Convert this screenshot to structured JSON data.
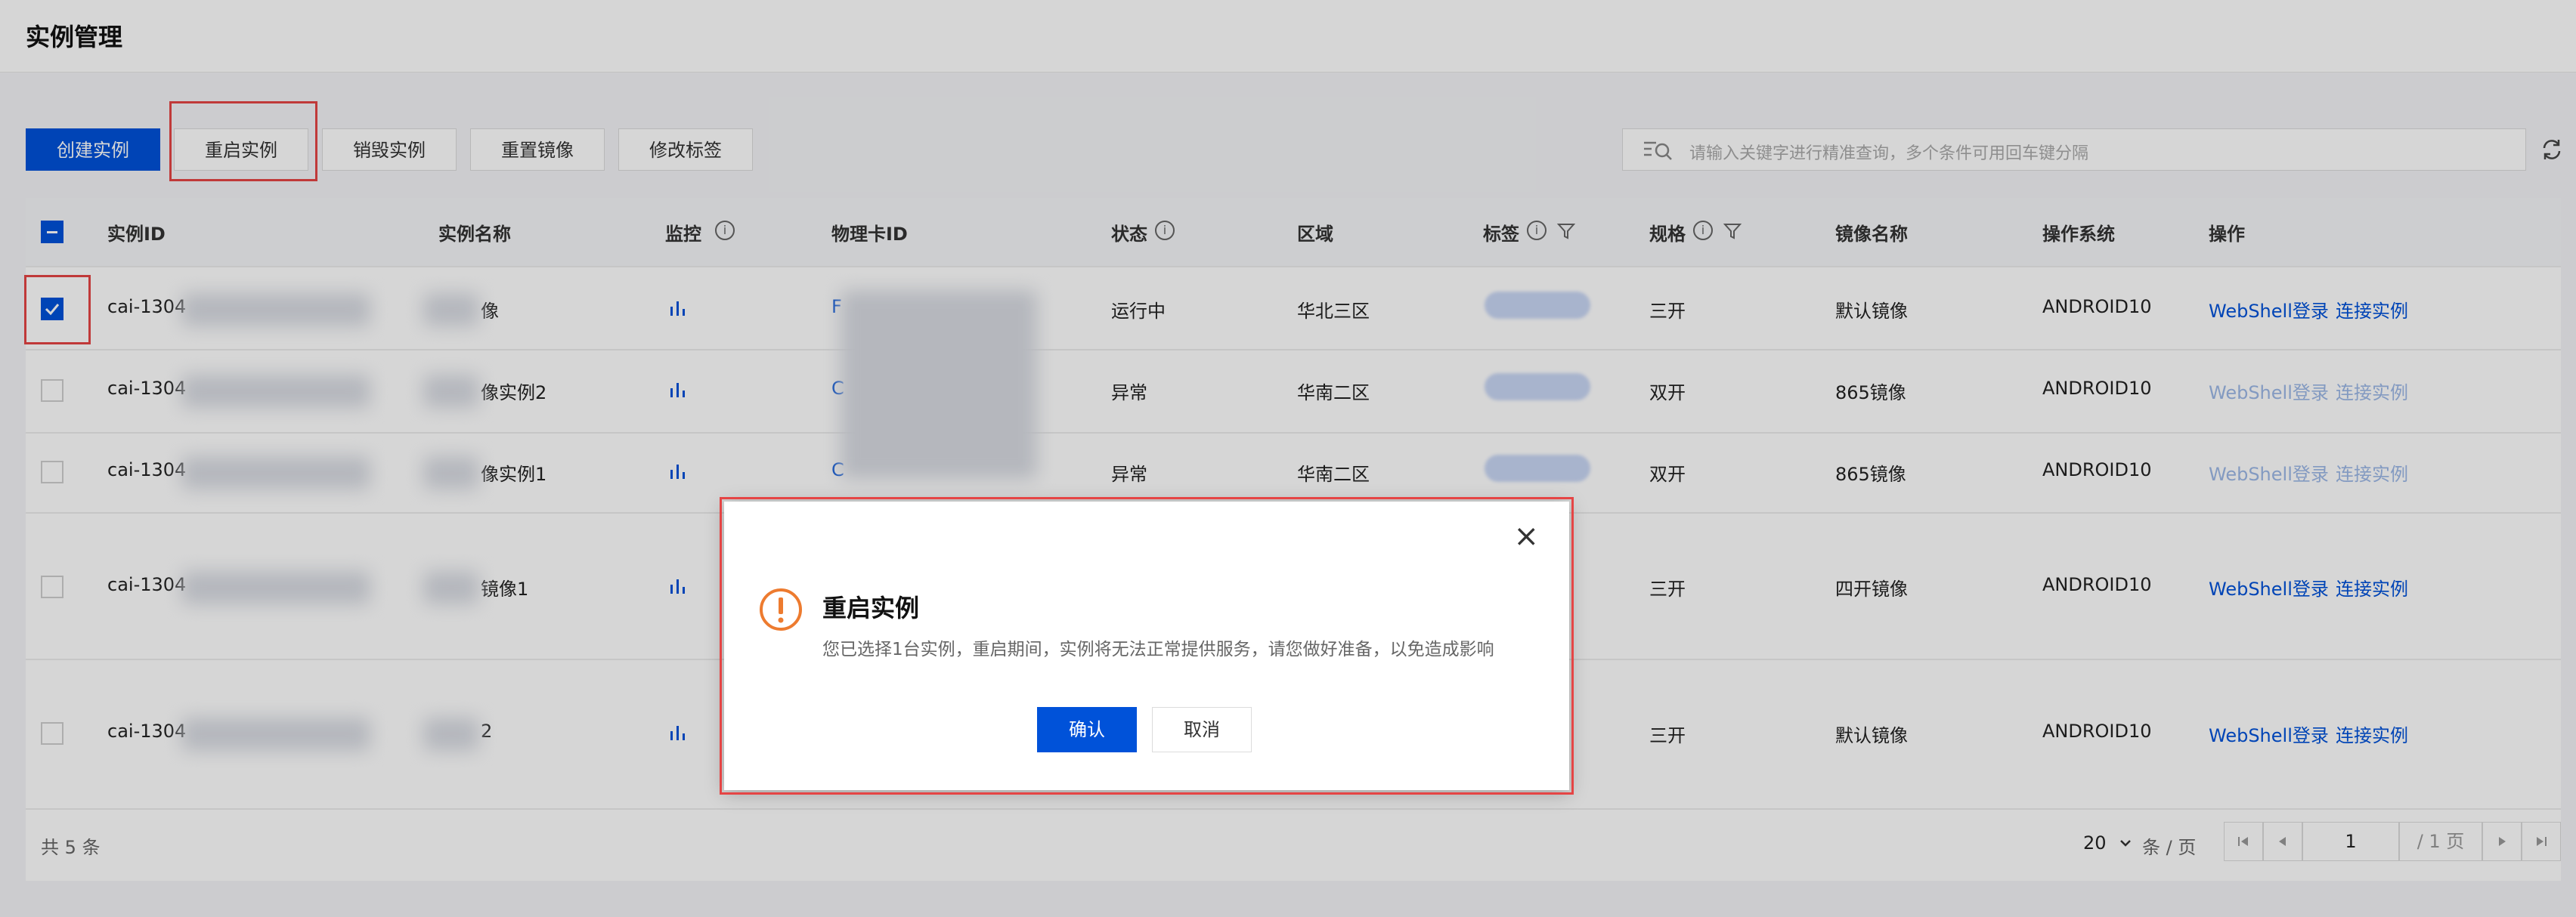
{
  "page": {
    "title": "实例管理"
  },
  "toolbar": {
    "create": "创建实例",
    "restart": "重启实例",
    "destroy": "销毁实例",
    "reset_image": "重置镜像",
    "edit_tags": "修改标签",
    "search_placeholder": "请输入关键字进行精准查询，多个条件可用回车键分隔"
  },
  "table": {
    "headers": [
      "实例ID",
      "实例名称",
      "监控",
      "物理卡ID",
      "状态",
      "区域",
      "标签",
      "规格",
      "镜像名称",
      "操作系统",
      "操作"
    ],
    "rows": [
      {
        "id": "cai-1304",
        "name": "像",
        "card": "F",
        "status": "运行中",
        "region": "华北三区",
        "spec": "三开",
        "image": "默认镜像",
        "os": "ANDROID10",
        "act1": "WebShell登录",
        "act2": "连接实例",
        "checked": true
      },
      {
        "id": "cai-1304",
        "name": "像实例2",
        "card": "C",
        "status": "异常",
        "region": "华南二区",
        "spec": "双开",
        "image": "865镜像",
        "os": "ANDROID10",
        "act1": "WebShell登录",
        "act2": "连接实例",
        "checked": false
      },
      {
        "id": "cai-1304",
        "name": "像实例1",
        "card": "C",
        "status": "异常",
        "region": "华南二区",
        "spec": "双开",
        "image": "865镜像",
        "os": "ANDROID10",
        "act1": "WebShell登录",
        "act2": "连接实例",
        "checked": false
      },
      {
        "id": "cai-1304",
        "name": "镜像1",
        "card": "",
        "status": "",
        "region": "",
        "spec": "三开",
        "image": "四开镜像",
        "os": "ANDROID10",
        "act1": "WebShell登录",
        "act2": "连接实例",
        "checked": false
      },
      {
        "id": "cai-1304",
        "name": "2",
        "card": "",
        "status": "",
        "region": "",
        "spec": "三开",
        "image": "默认镜像",
        "os": "ANDROID10",
        "act1": "WebShell登录",
        "act2": "连接实例",
        "checked": false
      }
    ]
  },
  "footer": {
    "total": "共 5 条",
    "page_size": "20",
    "page_size_unit": "条 / 页",
    "current_page": "1",
    "total_pages": "/ 1 页"
  },
  "modal": {
    "title": "重启实例",
    "message": "您已选择1台实例，重启期间，实例将无法正常提供服务，请您做好准备，以免造成影响",
    "confirm": "确认",
    "cancel": "取消",
    "close_glyph": "×"
  }
}
